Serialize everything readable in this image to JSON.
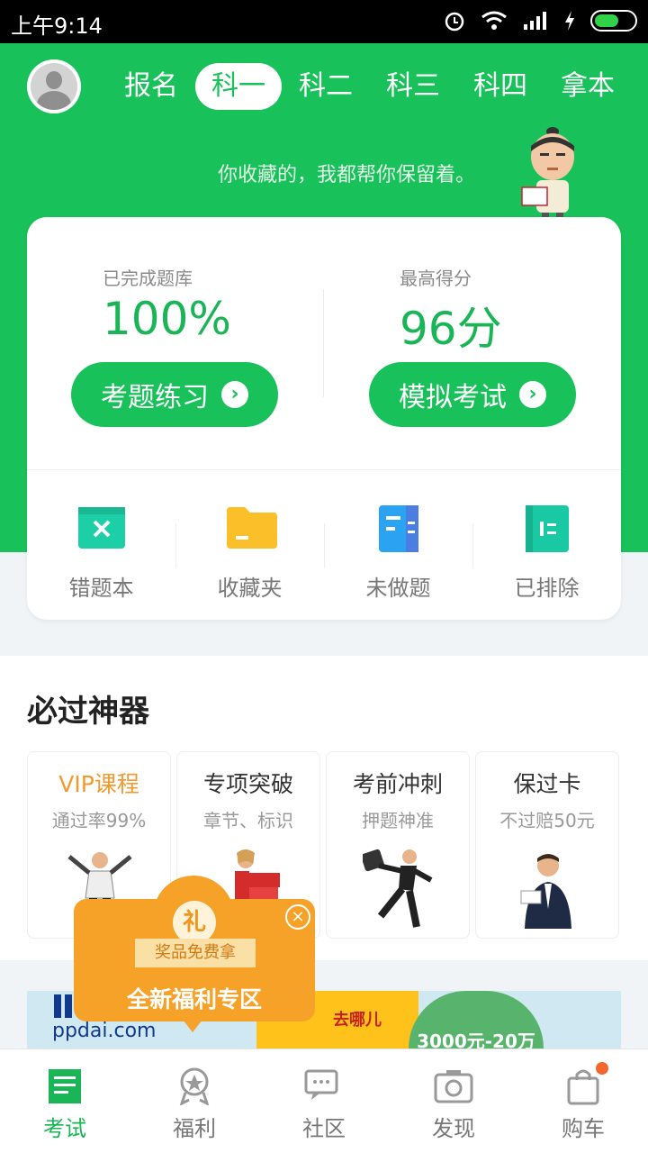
{
  "status_bar": {
    "time": "上午9:14"
  },
  "tabs": [
    {
      "label": "报名"
    },
    {
      "label": "科一"
    },
    {
      "label": "科二"
    },
    {
      "label": "科三"
    },
    {
      "label": "科四"
    },
    {
      "label": "拿本"
    }
  ],
  "active_tab": "科一",
  "slogan": "你收藏的，我都帮你保留着。",
  "stats": {
    "completed": {
      "label": "已完成题库",
      "value": "100%",
      "button": "考题练习"
    },
    "best": {
      "label": "最高得分",
      "value": "96分",
      "button": "模拟考试"
    }
  },
  "tools": [
    {
      "label": "错题本",
      "icon": "wrong-book-icon"
    },
    {
      "label": "收藏夹",
      "icon": "folder-icon"
    },
    {
      "label": "未做题",
      "icon": "undone-icon"
    },
    {
      "label": "已排除",
      "icon": "excluded-icon"
    }
  ],
  "section": {
    "title": "必过神器",
    "features": [
      {
        "title": "VIP课程",
        "subtitle": "通过率99%"
      },
      {
        "title": "专项突破",
        "subtitle": "章节、标识"
      },
      {
        "title": "考前冲刺",
        "subtitle": "押题神准"
      },
      {
        "title": "保过卡",
        "subtitle": "不过赔50元"
      }
    ]
  },
  "promo_popup": {
    "badge": "礼",
    "ribbon": "奖品免费拿",
    "title": "全新福利专区"
  },
  "banner": {
    "url": "ppdai.com",
    "slogan": "去哪儿",
    "amount": "3000元-20万"
  },
  "bottom_nav": [
    {
      "label": "考试"
    },
    {
      "label": "福利"
    },
    {
      "label": "社区"
    },
    {
      "label": "发现"
    },
    {
      "label": "购车"
    }
  ],
  "colors": {
    "brand_green": "#19c15a",
    "orange": "#f6a128",
    "vip_orange": "#f39a2e"
  }
}
